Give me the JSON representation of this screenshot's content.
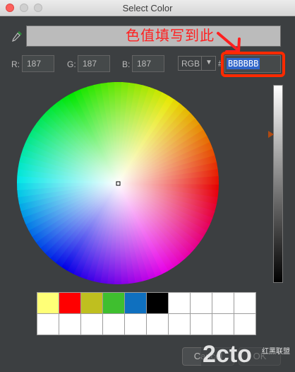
{
  "window": {
    "title": "Select Color"
  },
  "annotation": {
    "text": "色值填写到此"
  },
  "rgb": {
    "r_label": "R:",
    "r_value": "187",
    "g_label": "G:",
    "g_value": "187",
    "b_label": "B:",
    "b_value": "187"
  },
  "mode": {
    "selected": "RGB",
    "hash": "#"
  },
  "hex": {
    "value": "BBBBBB"
  },
  "preview_color": "#bbbbbb",
  "palette": {
    "row1": [
      "#ffff77",
      "#ff0000",
      "#bfbf1f",
      "#3fbf2f",
      "#0f70bf",
      "#000000",
      "#ffffff",
      "#ffffff",
      "#ffffff",
      "#ffffff"
    ],
    "row2": [
      "#ffffff",
      "#ffffff",
      "#ffffff",
      "#ffffff",
      "#ffffff",
      "#ffffff",
      "#ffffff",
      "#ffffff",
      "#ffffff",
      "#ffffff"
    ]
  },
  "buttons": {
    "cancel": "Cancel",
    "ok": "OK"
  },
  "watermark": {
    "logo": "2cto",
    "caption": "红黑联盟"
  },
  "icons": {
    "dropper": "eyedropper-icon",
    "arrow": "red-arrow-annotation",
    "caret": "chevron-down-icon"
  }
}
